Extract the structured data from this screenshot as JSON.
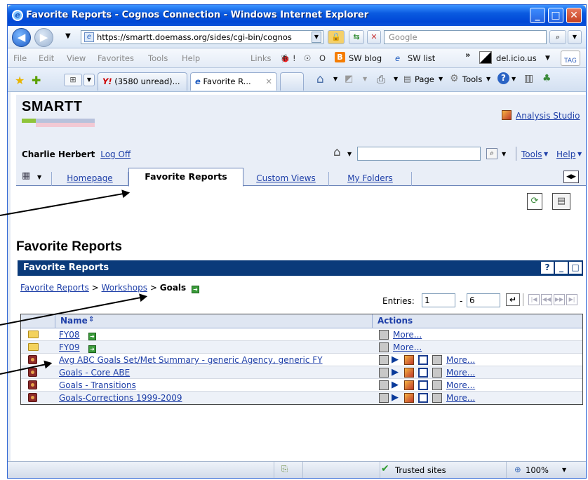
{
  "window": {
    "title": "Favorite Reports - Cognos Connection - Windows Internet Explorer"
  },
  "address": {
    "url": "https://smartt.doemass.org/sides/cgi-bin/cognos",
    "search_placeholder": "Google"
  },
  "menu": {
    "items": [
      "File",
      "Edit",
      "View",
      "Favorites",
      "Tools",
      "Help"
    ],
    "links_label": "Links",
    "link_items": [
      "!",
      "O",
      "SW blog",
      "SW list"
    ],
    "delicious": "del.icio.us",
    "tag": "TAG"
  },
  "browser_tabs": [
    {
      "label": "(3580 unread)..."
    },
    {
      "label": "Favorite R..."
    }
  ],
  "command_bar": {
    "page": "Page",
    "tools": "Tools"
  },
  "cognos": {
    "logo": "SMARTT",
    "analysis_studio": "Analysis Studio",
    "user": "Charlie Herbert",
    "log_off": "Log Off",
    "tools": "Tools",
    "help": "Help",
    "tabs": [
      "Homepage",
      "Favorite Reports",
      "Custom Views",
      "My Folders"
    ],
    "page_title": "Favorite Reports",
    "portlet_title": "Favorite Reports",
    "breadcrumb": {
      "root": "Favorite Reports",
      "sep": ">",
      "workshops": "Workshops",
      "current": "Goals"
    },
    "entries": {
      "label": "Entries:",
      "from": "1",
      "dash": "-",
      "to": "6"
    },
    "table": {
      "headers": {
        "name": "Name",
        "actions": "Actions"
      },
      "rows": [
        {
          "name": "FY08",
          "type": "folder",
          "more": "More..."
        },
        {
          "name": "FY09",
          "type": "folder",
          "more": "More..."
        },
        {
          "name": "Avg ABC Goals Set/Met Summary - generic Agency, generic FY",
          "type": "report",
          "more": "More..."
        },
        {
          "name": "Goals - Core ABE",
          "type": "report",
          "more": "More..."
        },
        {
          "name": "Goals - Transitions",
          "type": "report",
          "more": "More..."
        },
        {
          "name": "Goals-Corrections 1999-2009",
          "type": "report",
          "more": "More..."
        }
      ]
    }
  },
  "status": {
    "zone": "Trusted sites",
    "zoom": "100%"
  },
  "colors": {
    "title_bar": "#0a5ae0",
    "portlet_bar": "#0a3a7a",
    "link": "#1e3fa8"
  }
}
